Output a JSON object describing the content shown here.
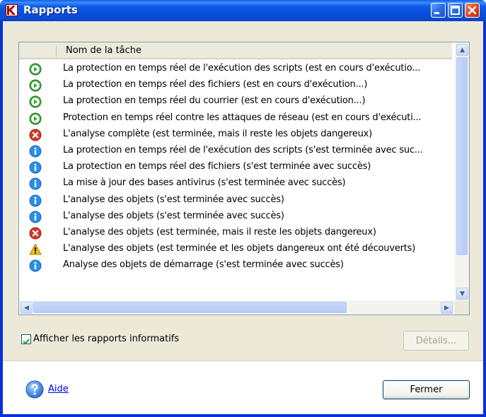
{
  "window": {
    "title": "Rapports"
  },
  "list": {
    "column_header": "Nom de la tâche",
    "rows": [
      {
        "icon": "running-icon",
        "text": "La protection en temps réel de l'exécution des scripts (est en cours d'exécutio..."
      },
      {
        "icon": "running-icon",
        "text": "La protection en temps réel des fichiers (est en cours d'exécution...)"
      },
      {
        "icon": "running-icon",
        "text": "La protection en temps réel du courrier (est en cours d'exécution...)"
      },
      {
        "icon": "running-icon",
        "text": "Protection en temps réel contre les attaques de réseau (est en cours d'exécuti..."
      },
      {
        "icon": "error-icon",
        "text": "L'analyse complète (est terminée, mais il reste les objets dangereux)"
      },
      {
        "icon": "info-icon",
        "text": "La protection en temps réel de l'exécution des scripts (s'est terminée avec suc..."
      },
      {
        "icon": "info-icon",
        "text": "La protection en temps réel des fichiers (s'est terminée avec succès)"
      },
      {
        "icon": "info-icon",
        "text": "La mise à jour des bases antivirus (s'est terminée avec succès)"
      },
      {
        "icon": "info-icon",
        "text": "L'analyse des objets (s'est terminée avec succès)"
      },
      {
        "icon": "info-icon",
        "text": "L'analyse des objets (s'est terminée avec succès)"
      },
      {
        "icon": "error-icon",
        "text": "L'analyse des objets (est terminée, mais il reste les objets dangereux)"
      },
      {
        "icon": "warning-icon",
        "text": "L'analyse des objets (est terminée et les objets dangereux ont été découverts)"
      },
      {
        "icon": "info-icon",
        "text": "Analyse des objets de démarrage (s'est terminée avec succès)"
      }
    ]
  },
  "options": {
    "show_info_reports_label": "Afficher les rapports informatifs",
    "show_info_reports_checked": true
  },
  "buttons": {
    "details": "Détails...",
    "close": "Fermer"
  },
  "help": {
    "label": "Aide"
  },
  "colors": {
    "title_bar": "#0a5ef0",
    "running": "#3aa83a",
    "error": "#d23a2a",
    "info": "#1e88e5",
    "warning": "#f4c20d"
  }
}
